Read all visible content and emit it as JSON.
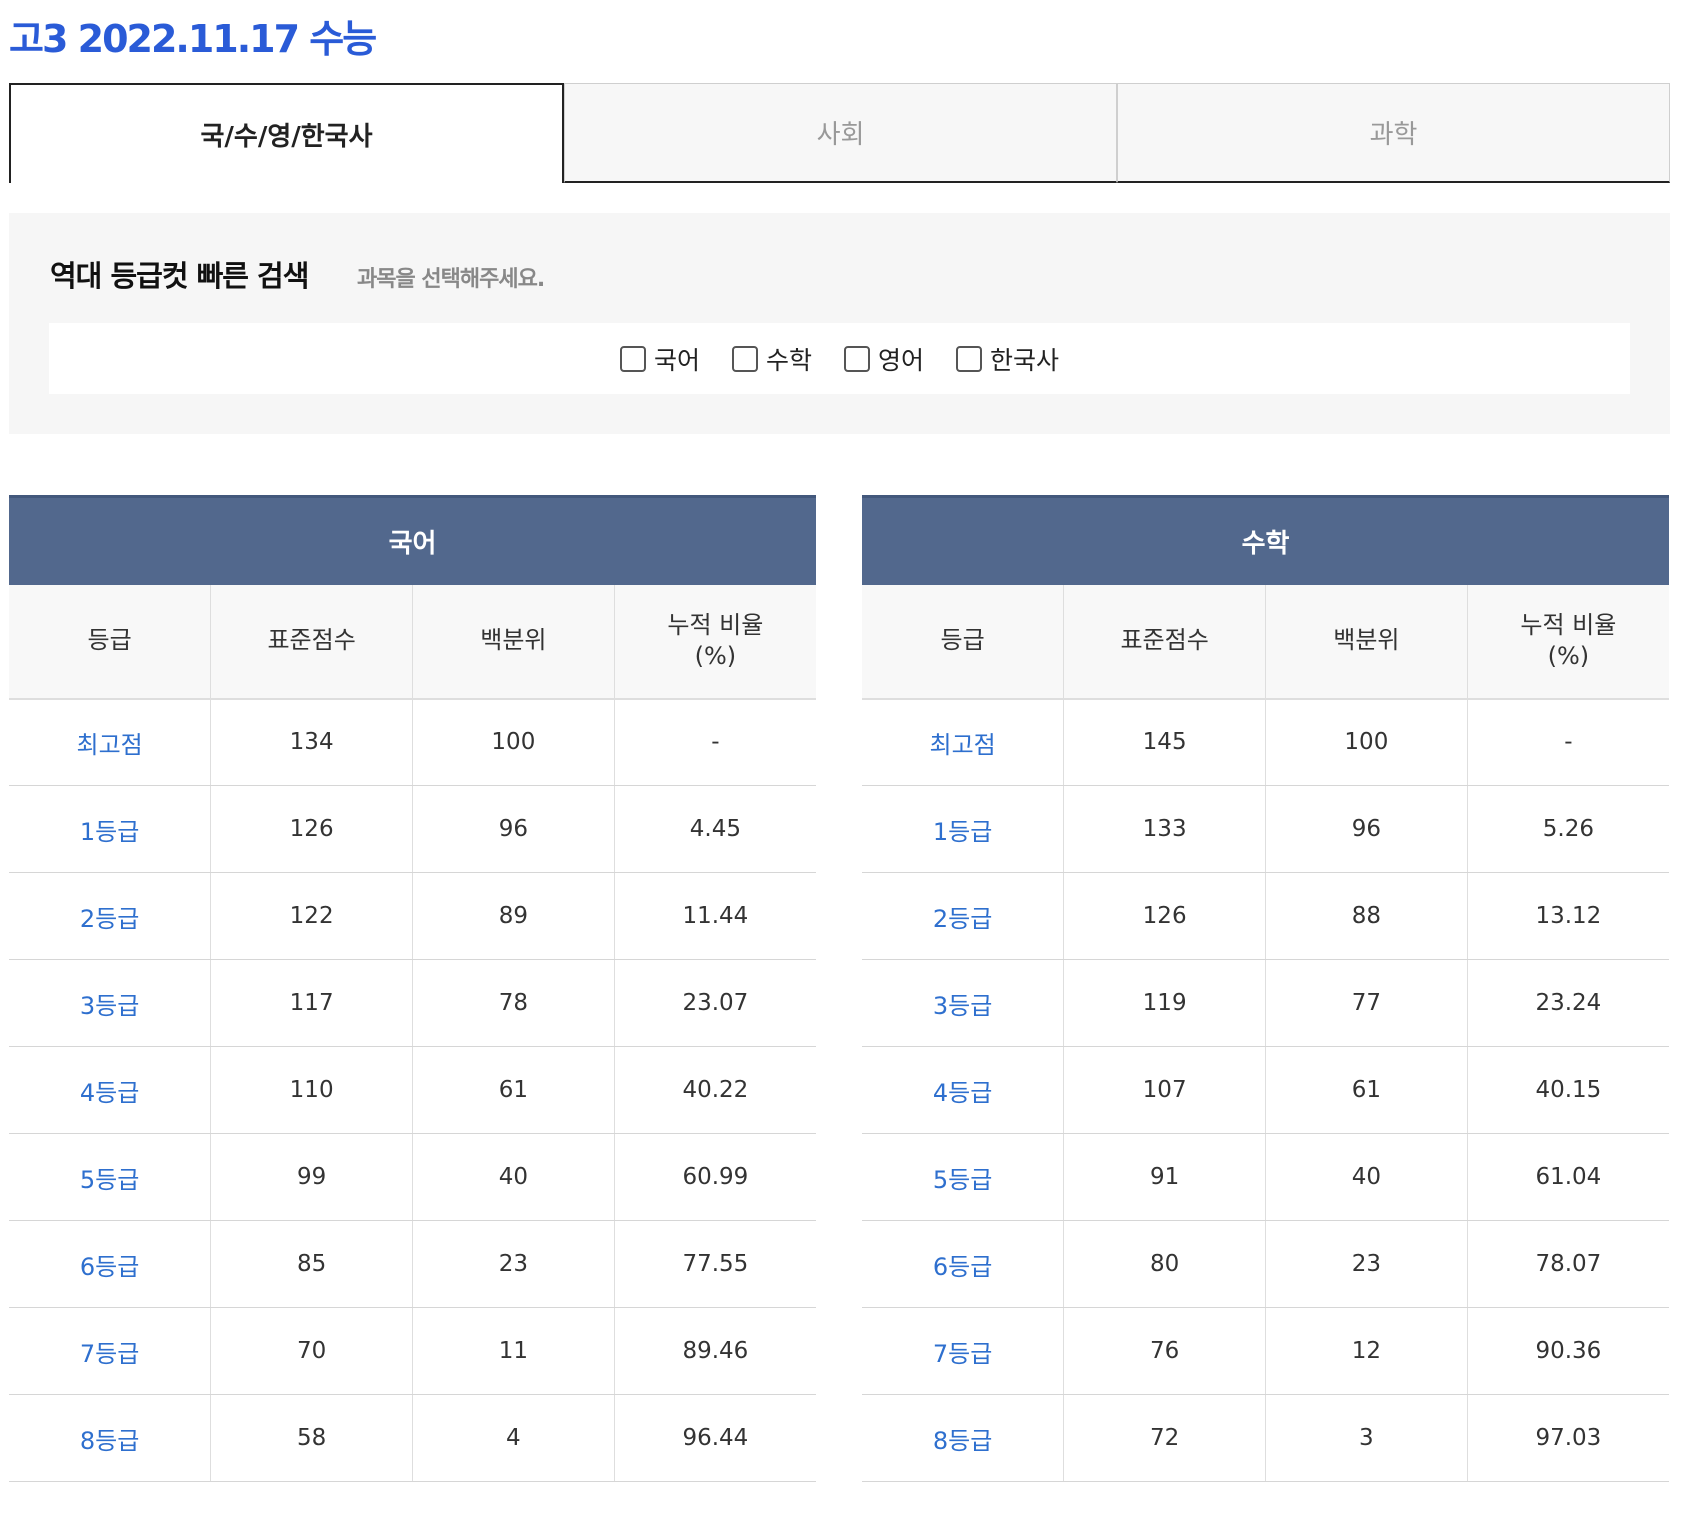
{
  "page": {
    "title": "고3 2022.11.17 수능"
  },
  "tabs": [
    {
      "label": "국/수/영/한국사",
      "active": true
    },
    {
      "label": "사회",
      "active": false
    },
    {
      "label": "과학",
      "active": false
    }
  ],
  "search": {
    "title": "역대 등급컷 빠른 검색",
    "subtitle": "과목을 선택해주세요.",
    "options": [
      "국어",
      "수학",
      "영어",
      "한국사"
    ]
  },
  "columns": [
    "등급",
    "표준점수",
    "백분위",
    "누적 비율",
    "(%)"
  ],
  "tables": [
    {
      "subject": "국어",
      "rows": [
        [
          "최고점",
          "134",
          "100",
          "-"
        ],
        [
          "1등급",
          "126",
          "96",
          "4.45"
        ],
        [
          "2등급",
          "122",
          "89",
          "11.44"
        ],
        [
          "3등급",
          "117",
          "78",
          "23.07"
        ],
        [
          "4등급",
          "110",
          "61",
          "40.22"
        ],
        [
          "5등급",
          "99",
          "40",
          "60.99"
        ],
        [
          "6등급",
          "85",
          "23",
          "77.55"
        ],
        [
          "7등급",
          "70",
          "11",
          "89.46"
        ],
        [
          "8등급",
          "58",
          "4",
          "96.44"
        ]
      ]
    },
    {
      "subject": "수학",
      "rows": [
        [
          "최고점",
          "145",
          "100",
          "-"
        ],
        [
          "1등급",
          "133",
          "96",
          "5.26"
        ],
        [
          "2등급",
          "126",
          "88",
          "13.12"
        ],
        [
          "3등급",
          "119",
          "77",
          "23.24"
        ],
        [
          "4등급",
          "107",
          "61",
          "40.15"
        ],
        [
          "5등급",
          "91",
          "40",
          "61.04"
        ],
        [
          "6등급",
          "80",
          "23",
          "78.07"
        ],
        [
          "7등급",
          "76",
          "12",
          "90.36"
        ],
        [
          "8등급",
          "72",
          "3",
          "97.03"
        ]
      ]
    }
  ],
  "colors": {
    "title": "#2a5bd7",
    "table_header": "#52688d",
    "grade_link": "#2e6fce"
  }
}
